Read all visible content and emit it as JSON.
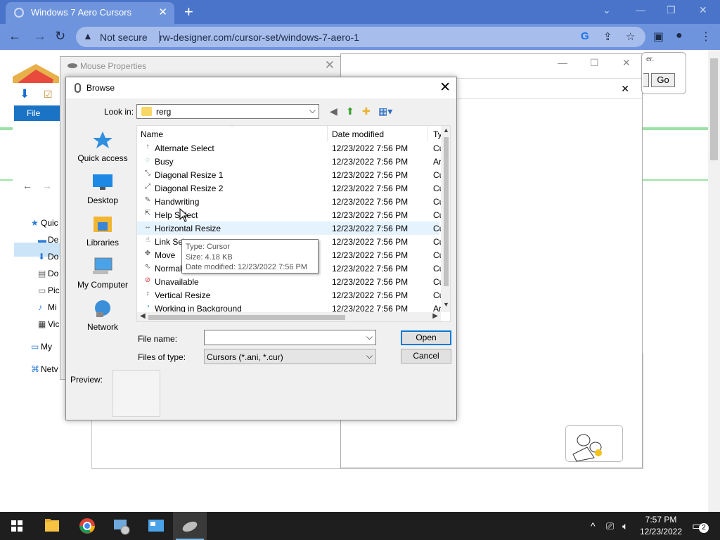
{
  "browser": {
    "tab_title": "Windows 7 Aero Cursors",
    "tab_close": "✕",
    "new_tab": "+",
    "not_secure": "Not secure",
    "url": "rw-designer.com/cursor-set/windows-7-aero-1",
    "window_minimize": "—",
    "window_restore": "❐",
    "window_close": "✕",
    "chevron": "⌄"
  },
  "page": {
    "go_label": "Go",
    "partial_text": "er.",
    "search_close": "✕"
  },
  "explorer": {
    "file_tab": "File",
    "sidebar": [
      {
        "label": "Quic",
        "icon": "star-icon"
      },
      {
        "label": "De",
        "icon": "desktop-icon"
      },
      {
        "label": "Do",
        "icon": "download-icon"
      },
      {
        "label": "Do",
        "icon": "document-icon"
      },
      {
        "label": "Pic",
        "icon": "pictures-icon"
      },
      {
        "label": "Mi",
        "icon": "music-icon"
      },
      {
        "label": "Vic",
        "icon": "video-icon"
      },
      {
        "label": "My",
        "icon": "computer-icon"
      },
      {
        "label": "Netv",
        "icon": "network-icon"
      }
    ]
  },
  "mouse_properties": {
    "title": "Mouse Properties",
    "close": "✕"
  },
  "cpanel": {
    "minimize": "—",
    "maximize": "☐",
    "close": "✕"
  },
  "browse": {
    "title": "Browse",
    "close": "✕",
    "look_in_label": "Look in:",
    "look_in_value": "rerg",
    "places": [
      {
        "label": "Quick access",
        "icon": "quick-access-icon"
      },
      {
        "label": "Desktop",
        "icon": "desktop-icon"
      },
      {
        "label": "Libraries",
        "icon": "libraries-icon"
      },
      {
        "label": "My Computer",
        "icon": "my-computer-icon"
      },
      {
        "label": "Network",
        "icon": "network-icon"
      }
    ],
    "columns": {
      "name": "Name",
      "date": "Date modified",
      "type": "Ty"
    },
    "files": [
      {
        "name": "Alternate Select",
        "date": "12/23/2022 7:56 PM",
        "type": "Cu",
        "icon": "↑"
      },
      {
        "name": "Busy",
        "date": "12/23/2022 7:56 PM",
        "type": "Ar",
        "icon": "◌"
      },
      {
        "name": "Diagonal Resize 1",
        "date": "12/23/2022 7:56 PM",
        "type": "Cu",
        "icon": "⤡"
      },
      {
        "name": "Diagonal Resize 2",
        "date": "12/23/2022 7:56 PM",
        "type": "Cu",
        "icon": "⤢"
      },
      {
        "name": "Handwriting",
        "date": "12/23/2022 7:56 PM",
        "type": "Cu",
        "icon": "✎"
      },
      {
        "name": "Help Select",
        "date": "12/23/2022 7:56 PM",
        "type": "Cu",
        "icon": "⇱"
      },
      {
        "name": "Horizontal Resize",
        "date": "12/23/2022 7:56 PM",
        "type": "Cu",
        "icon": "↔"
      },
      {
        "name": "Link Select",
        "date": "12/23/2022 7:56 PM",
        "type": "Cu",
        "icon": "☝"
      },
      {
        "name": "Move",
        "date": "12/23/2022 7:56 PM",
        "type": "Cu",
        "icon": "✥"
      },
      {
        "name": "Normal Select",
        "date": "12/23/2022 7:56 PM",
        "type": "Cu",
        "icon": "⇖"
      },
      {
        "name": "Unavailable",
        "date": "12/23/2022 7:56 PM",
        "type": "Cu",
        "icon": "⊘"
      },
      {
        "name": "Vertical Resize",
        "date": "12/23/2022 7:56 PM",
        "type": "Cu",
        "icon": "↕"
      },
      {
        "name": "Working in Background",
        "date": "12/23/2022 7:56 PM",
        "type": "Ar",
        "icon": "◔"
      }
    ],
    "tooltip": {
      "type": "Type: Cursor",
      "size": "Size: 4.18 KB",
      "date": "Date modified: 12/23/2022 7:56 PM"
    },
    "file_name_label": "File name:",
    "file_name_value": "",
    "files_of_type_label": "Files of type:",
    "files_of_type_value": "Cursors (*.ani, *.cur)",
    "open_label": "Open",
    "cancel_label": "Cancel",
    "preview_label": "Preview:"
  },
  "taskbar": {
    "time": "7:57 PM",
    "date": "12/23/2022",
    "notification_count": "2"
  },
  "colors": {
    "chrome_tabstrip": "#4a74c9",
    "chrome_toolbar": "#6e94dd",
    "accent": "#0078d7",
    "taskbar": "#1e1e1e"
  }
}
